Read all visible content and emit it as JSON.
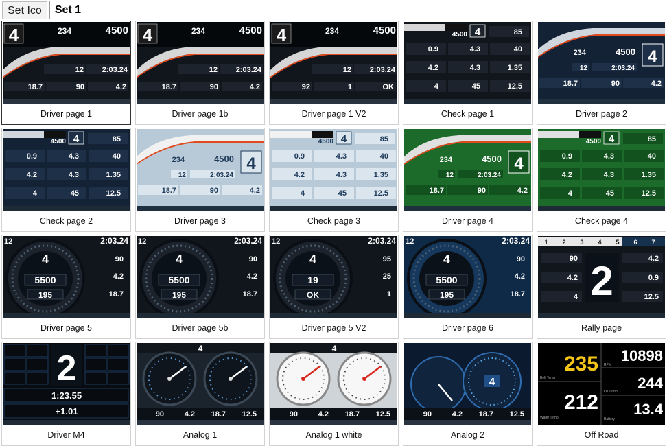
{
  "tabs": [
    {
      "label": "Set Ico",
      "active": false
    },
    {
      "label": "Set 1",
      "active": true
    }
  ],
  "cards": [
    {
      "label": "Driver page 1",
      "style": "driver",
      "theme": "dark",
      "gear": "4",
      "speed": "234",
      "rpm": "4500",
      "lap": "12",
      "laptime": "2:03.24",
      "b1": "18.7",
      "b2": "90",
      "b3": "4.2"
    },
    {
      "label": "Driver page 1b",
      "style": "driver",
      "theme": "dark",
      "gear": "4",
      "speed": "234",
      "rpm": "4500",
      "lap": "12",
      "laptime": "2:03.24",
      "b1": "18.7",
      "b2": "90",
      "b3": "4.2"
    },
    {
      "label": "Driver page 1 V2",
      "style": "driver",
      "theme": "dark",
      "gear": "4",
      "speed": "234",
      "rpm": "4500",
      "lap": "12",
      "laptime": "2:03.24",
      "b1": "92",
      "b2": "1",
      "b3": "OK"
    },
    {
      "label": "Check page 1",
      "style": "check",
      "theme": "dark",
      "gear": "4",
      "rpm": "4500",
      "vals": [
        "85",
        "0.9",
        "4.3",
        "40",
        "4.2",
        "4.3",
        "1.35",
        "4",
        "45",
        "12.5"
      ]
    },
    {
      "label": "Driver page 2",
      "style": "driver2",
      "theme": "navy",
      "gear": "4",
      "speed": "234",
      "rpm": "4500",
      "lap": "12",
      "laptime": "2:03.24",
      "b1": "18.7",
      "b2": "90",
      "b3": "4.2"
    },
    {
      "label": "Check page 2",
      "style": "check",
      "theme": "navy",
      "gear": "4",
      "rpm": "4500",
      "vals": [
        "85",
        "0.9",
        "4.3",
        "40",
        "4.2",
        "4.3",
        "1.35",
        "4",
        "45",
        "12.5"
      ]
    },
    {
      "label": "Driver page 3",
      "style": "driver2",
      "theme": "light",
      "gear": "4",
      "speed": "234",
      "rpm": "4500",
      "lap": "12",
      "laptime": "2:03.24",
      "b1": "18.7",
      "b2": "90",
      "b3": "4.2"
    },
    {
      "label": "Check page 3",
      "style": "check",
      "theme": "light",
      "gear": "4",
      "rpm": "4500",
      "vals": [
        "85",
        "0.9",
        "4.3",
        "40",
        "4.2",
        "4.3",
        "1.35",
        "4",
        "45",
        "12.5"
      ]
    },
    {
      "label": "Driver page 4",
      "style": "driver2",
      "theme": "green",
      "gear": "4",
      "speed": "234",
      "rpm": "4500",
      "lap": "12",
      "laptime": "2:03.24",
      "b1": "18.7",
      "b2": "90",
      "b3": "4.2"
    },
    {
      "label": "Check page 4",
      "style": "check",
      "theme": "green",
      "gear": "4",
      "rpm": "4500",
      "vals": [
        "85",
        "0.9",
        "4.3",
        "40",
        "4.2",
        "4.3",
        "1.35",
        "4",
        "45",
        "12.5"
      ]
    },
    {
      "label": "Driver page 5",
      "style": "round",
      "theme": "dark",
      "gear": "4",
      "big": "5500",
      "speed": "195",
      "side": [
        "12",
        "2:03.24",
        "90",
        "4.2",
        "18.7"
      ]
    },
    {
      "label": "Driver page 5b",
      "style": "round",
      "theme": "dark",
      "gear": "4",
      "big": "5500",
      "speed": "195",
      "side": [
        "12",
        "2:03.24",
        "90",
        "4.2",
        "18.7"
      ]
    },
    {
      "label": "Driver page 5 V2",
      "style": "round",
      "theme": "dark",
      "gear": "4",
      "big": "19",
      "speed": "OK",
      "side": [
        "12",
        "2:03.24",
        "95",
        "25",
        "1"
      ]
    },
    {
      "label": "Driver page 6",
      "style": "round",
      "theme": "blue",
      "gear": "4",
      "big": "5500",
      "speed": "195",
      "side": [
        "12",
        "2:03.24",
        "90",
        "4.2",
        "18.7"
      ]
    },
    {
      "label": "Rally page",
      "style": "rally",
      "theme": "dark",
      "gear": "2",
      "top": [
        "1",
        "2",
        "3",
        "4",
        "5",
        "6",
        "7"
      ],
      "side": [
        "90",
        "4.2",
        "4",
        "4.2",
        "0.9",
        "12.5"
      ]
    },
    {
      "label": "Driver M4",
      "style": "m4",
      "theme": "dark",
      "gear": "2",
      "laptime": "1:23.55",
      "delta": "+1.01"
    },
    {
      "label": "Analog 1",
      "style": "analog",
      "theme": "dark",
      "gear": "4",
      "bottom": [
        "90",
        "4.2",
        "18.7",
        "12.5"
      ]
    },
    {
      "label": "Analog 1 white",
      "style": "analog",
      "theme": "white",
      "gear": "4",
      "bottom": [
        "90",
        "4.2",
        "18.7",
        "12.5"
      ]
    },
    {
      "label": "Analog 2",
      "style": "analog2",
      "theme": "dark",
      "gear": "4",
      "bottom": [
        "90",
        "4.2",
        "18.7",
        "12.5"
      ]
    },
    {
      "label": "Off Road",
      "style": "offroad",
      "theme": "dark",
      "vals": [
        "235",
        "10898",
        "244",
        "212",
        "13.4"
      ],
      "labels": [
        "Belt Temp",
        "RPM",
        "Oil Temp",
        "Water Temp",
        "Battery"
      ]
    }
  ]
}
